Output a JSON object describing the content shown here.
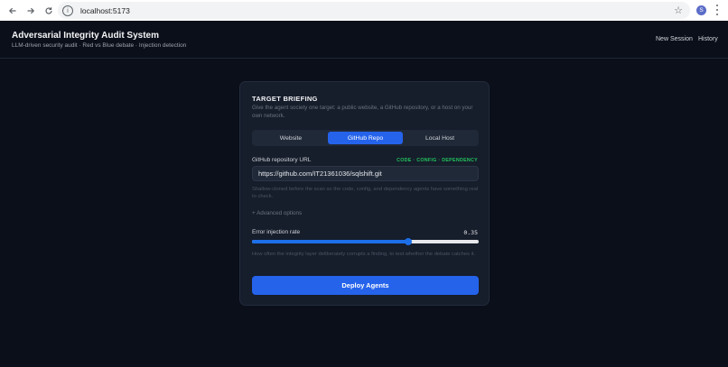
{
  "browser": {
    "url": "localhost:5173",
    "profile_initial": "S",
    "icons": {
      "back": "arrow-left-icon",
      "forward": "arrow-right-icon",
      "reload": "reload-icon",
      "site_info": "info-icon",
      "bookmark": "star-icon",
      "menu": "kebab-icon"
    }
  },
  "header": {
    "title": "Adversarial Integrity Audit System",
    "subtitle": "LLM-driven security audit · Red vs Blue debate · Injection detection",
    "nav": {
      "new_session": "New Session",
      "history": "History"
    }
  },
  "briefing": {
    "title": "TARGET BRIEFING",
    "description": "Give the agent society one target: a public website, a GitHub repository, or a host on your own network.",
    "tabs": [
      {
        "label": "Website",
        "active": false
      },
      {
        "label": "GitHub Repo",
        "active": true
      },
      {
        "label": "Local Host",
        "active": false
      }
    ],
    "repo": {
      "label": "GitHub repository URL",
      "tag": "CODE · CONFIG · DEPENDENCY",
      "value": "https://github.com/IT21361036/sqlshift.git",
      "help": "Shallow-cloned before the scan so the code, config, and dependency agents have something real to check."
    },
    "advanced_toggle": "+ Advanced options",
    "error_injection": {
      "label": "Error injection rate",
      "value": "0.35",
      "fraction": 0.69,
      "help": "How often the integrity layer deliberately corrupts a finding, to test whether the debate catches it."
    },
    "deploy_label": "Deploy Agents"
  },
  "colors": {
    "accent": "#2563eb",
    "tag_green": "#22c55e",
    "background": "#0b0f19",
    "card": "#161d2b"
  }
}
